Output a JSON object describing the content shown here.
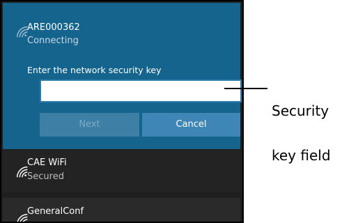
{
  "active_network": {
    "name": "ARE000362",
    "status": "Connecting",
    "icon": "wifi-icon",
    "prompt": "Enter the network security key",
    "key_value": "",
    "buttons": {
      "next_label": "Next",
      "cancel_label": "Cancel"
    }
  },
  "networks": [
    {
      "name": "CAE WiFi",
      "status": "Secured",
      "icon": "wifi-icon"
    },
    {
      "name": "GeneralConf",
      "icon": "wifi-icon"
    }
  ],
  "callout": {
    "line1": "Security",
    "line2": "key field"
  },
  "colors": {
    "accent": "#14648e",
    "panel_bg": "#1f1f1f",
    "button_next": "#3e7fa6",
    "button_cancel": "#3d86b5"
  }
}
